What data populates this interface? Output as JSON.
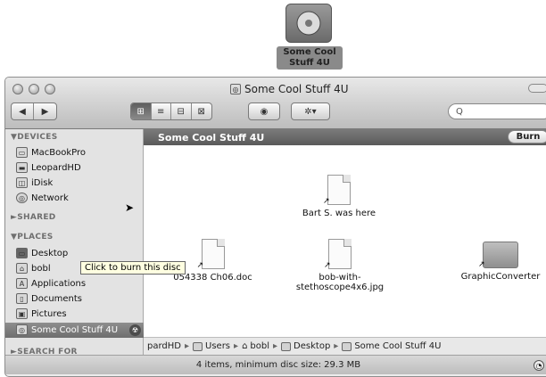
{
  "desktop": {
    "volume_label": "Some Cool Stuff 4U"
  },
  "window": {
    "title": "Some Cool Stuff 4U",
    "search_placeholder": "Q",
    "toolbar": {
      "back": "◀",
      "forward": "▶",
      "view_icon": "⊞",
      "view_list": "≡",
      "view_column": "⊟",
      "view_coverflow": "⊠",
      "quicklook": "◉",
      "action": "✲▾"
    }
  },
  "sidebar": {
    "devices_header": "▼DEVICES",
    "devices": [
      {
        "label": "MacBookPro",
        "icon": "laptop-icon"
      },
      {
        "label": "LeopardHD",
        "icon": "hard-drive-icon"
      },
      {
        "label": "iDisk",
        "icon": "idisk-icon"
      },
      {
        "label": "Network",
        "icon": "network-icon"
      }
    ],
    "shared_header": "►SHARED",
    "places_header": "▼PLACES",
    "places": [
      {
        "label": "Desktop",
        "icon": "desktop-icon"
      },
      {
        "label": "bobl",
        "icon": "home-icon"
      },
      {
        "label": "Applications",
        "icon": "applications-icon"
      },
      {
        "label": "Documents",
        "icon": "documents-icon"
      },
      {
        "label": "Pictures",
        "icon": "pictures-icon"
      }
    ],
    "selected_item": "Some Cool Stuff 4U",
    "search_header": "►SEARCH FOR",
    "tooltip": "Click to burn this disc"
  },
  "content": {
    "header": "Some Cool Stuff 4U",
    "burn_label": "Burn",
    "files": [
      {
        "name": "Bart S. was here",
        "kind": "document"
      },
      {
        "name": "054338 Ch06.doc",
        "kind": "document"
      },
      {
        "name": "bob-with-stethoscope4x6.jpg",
        "kind": "image"
      },
      {
        "name": "GraphicConverter",
        "kind": "folder"
      }
    ]
  },
  "pathbar": {
    "items": [
      "pardHD",
      "Users",
      "bobl",
      "Desktop",
      "Some Cool Stuff 4U"
    ]
  },
  "status": {
    "text": "4 items, minimum disc size: 29.3 MB"
  }
}
